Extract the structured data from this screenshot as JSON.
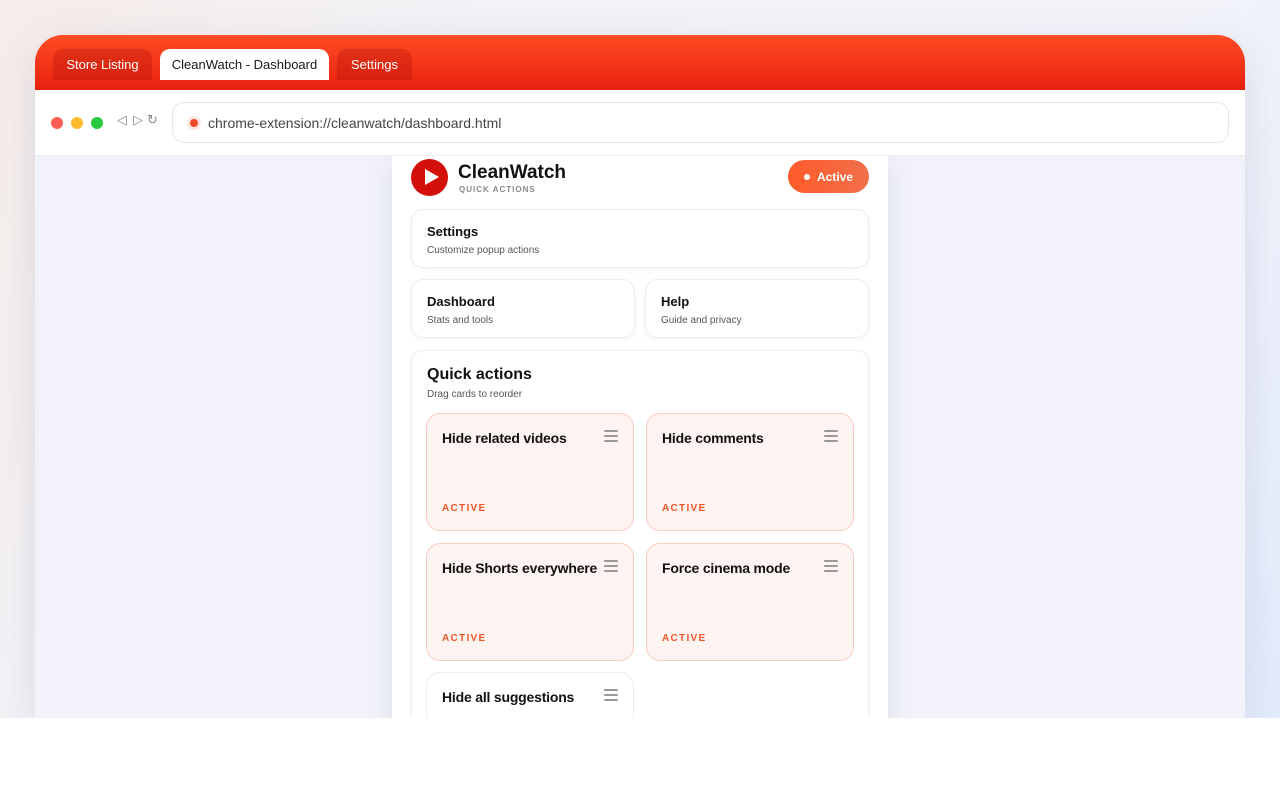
{
  "browser": {
    "tabs": [
      {
        "label": "Store Listing"
      },
      {
        "label": "CleanWatch - Dashboard"
      },
      {
        "label": "Settings"
      }
    ],
    "url": "chrome-extension://cleanwatch/dashboard.html",
    "nav_icons": [
      "back-icon",
      "forward-icon",
      "reload-icon"
    ],
    "back_glyph": "◁",
    "forward_glyph": "▷",
    "reload_glyph": "↻"
  },
  "header": {
    "brand": "CleanWatch",
    "subtitle": "QUICK ACTIONS",
    "status": "Active"
  },
  "nav_cards": {
    "settings": {
      "title": "Settings",
      "subtitle": "Customize popup actions"
    },
    "dashboard": {
      "title": "Dashboard",
      "subtitle": "Stats and tools"
    },
    "help": {
      "title": "Help",
      "subtitle": "Guide and privacy"
    }
  },
  "quick_actions": {
    "title": "Quick actions",
    "subtitle": "Drag cards to reorder",
    "items": [
      {
        "title": "Hide related videos",
        "status": "ACTIVE"
      },
      {
        "title": "Hide comments",
        "status": "ACTIVE"
      },
      {
        "title": "Hide Shorts everywhere",
        "status": "ACTIVE"
      },
      {
        "title": "Force cinema mode",
        "status": "ACTIVE"
      },
      {
        "title": "Hide all suggestions",
        "status": ""
      }
    ]
  },
  "colors": {
    "accent": "#f04a2a",
    "tabbar": "#ff4d24",
    "active_card_bg": "#fdf3f0",
    "active_card_border": "#f8cdbd"
  }
}
